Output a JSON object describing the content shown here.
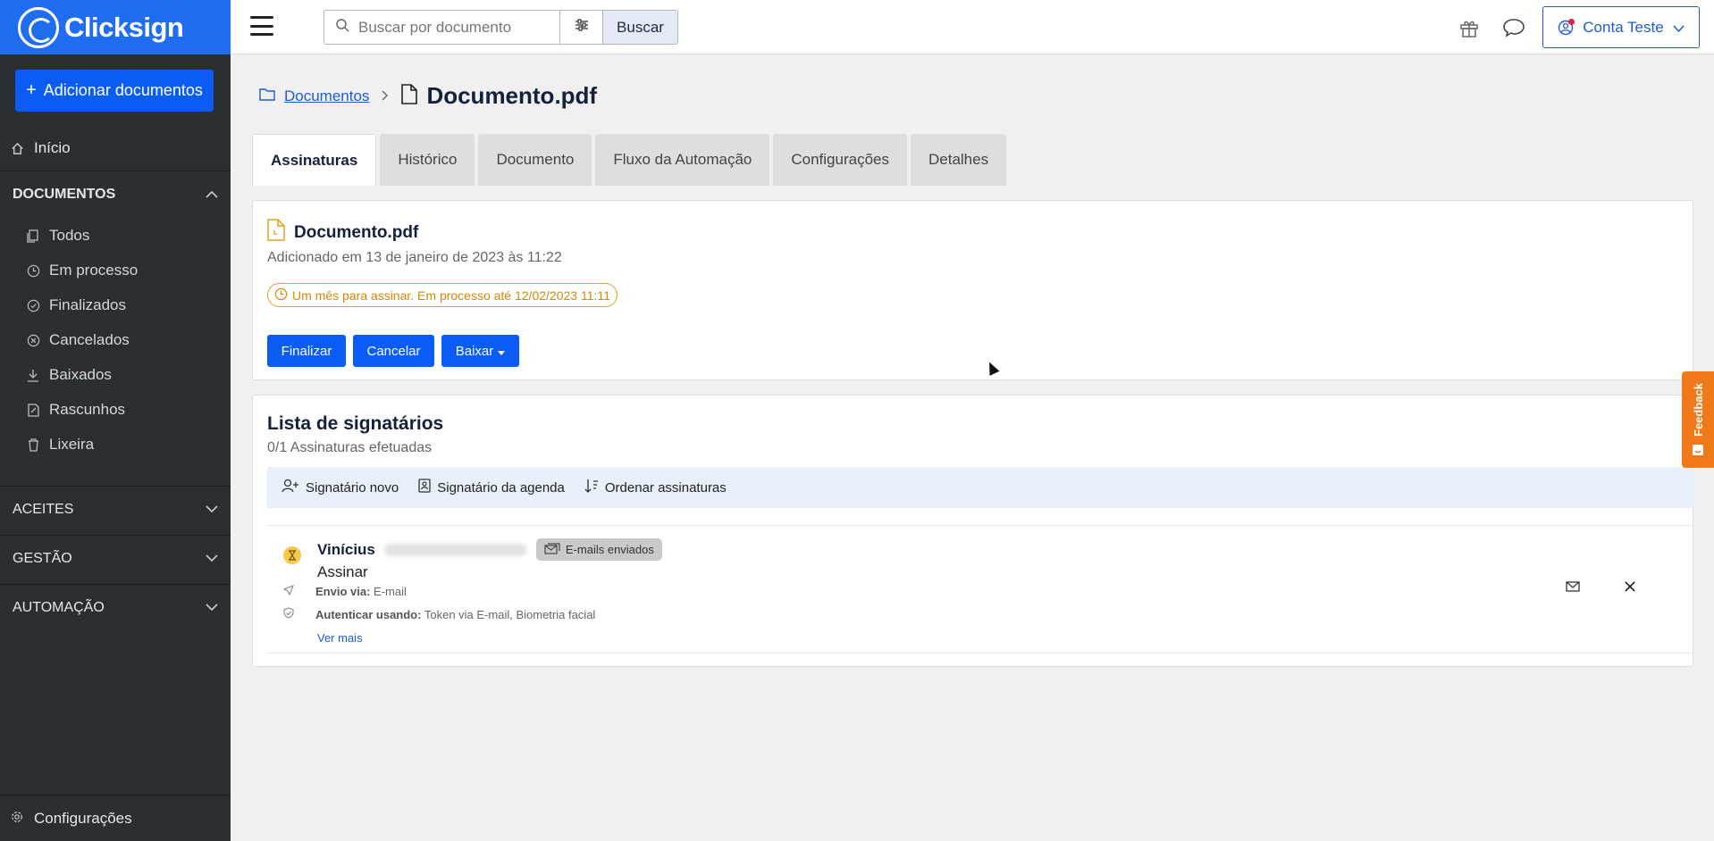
{
  "brand": {
    "name": "Clicksign",
    "accent": "#1f6ef2"
  },
  "sidebar": {
    "add_label": "Adicionar documentos",
    "home_label": "Início",
    "documents_section": "DOCUMENTOS",
    "doc_items": [
      {
        "label": "Todos",
        "icon": "files-icon"
      },
      {
        "label": "Em processo",
        "icon": "clock-icon"
      },
      {
        "label": "Finalizados",
        "icon": "check-circle-icon"
      },
      {
        "label": "Cancelados",
        "icon": "x-circle-icon"
      },
      {
        "label": "Baixados",
        "icon": "download-icon"
      },
      {
        "label": "Rascunhos",
        "icon": "draft-icon"
      },
      {
        "label": "Lixeira",
        "icon": "trash-icon"
      }
    ],
    "sections": [
      "ACEITES",
      "GESTÃO",
      "AUTOMAÇÃO"
    ],
    "settings_label": "Configurações"
  },
  "topbar": {
    "search_placeholder": "Buscar por documento",
    "search_button": "Buscar",
    "account_label": "Conta Teste"
  },
  "breadcrumb": {
    "root": "Documentos",
    "current": "Documento.pdf"
  },
  "tabs": [
    "Assinaturas",
    "Histórico",
    "Documento",
    "Fluxo da Automação",
    "Configurações",
    "Detalhes"
  ],
  "document": {
    "name": "Documento.pdf",
    "added": "Adicionado em 13 de janeiro de 2023 às 11:22",
    "deadline": "Um mês para assinar. Em processo até 12/02/2023 11:11",
    "buttons": {
      "finalize": "Finalizar",
      "cancel": "Cancelar",
      "download": "Baixar"
    }
  },
  "signers": {
    "title": "Lista de signatários",
    "count": "0/1 Assinaturas efetuadas",
    "toolbar": {
      "new": "Signatário novo",
      "agenda": "Signatário da agenda",
      "order": "Ordenar assinaturas"
    },
    "rows": [
      {
        "name": "Vinícius",
        "status_chip": "E-mails enviados",
        "action": "Assinar",
        "send_via_label": "Envio via:",
        "send_via_value": "E-mail",
        "auth_label": "Autenticar usando:",
        "auth_value": "Token via E-mail, Biometria facial",
        "more": "Ver mais"
      }
    ]
  },
  "feedback_label": "Feedback"
}
